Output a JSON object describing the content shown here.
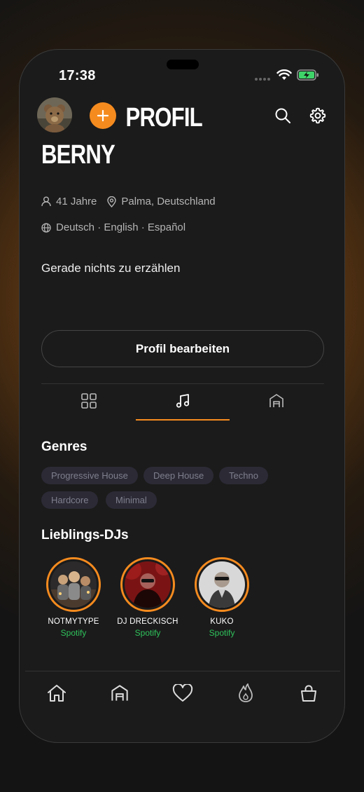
{
  "status_bar": {
    "time": "17:38"
  },
  "header": {
    "title_line1": "PROFIL",
    "title_line2": "BERNY"
  },
  "profile": {
    "age": "41 Jahre",
    "location": "Palma, Deutschland",
    "languages": "Deutsch · English · Español",
    "bio": "Gerade nichts zu erzählen"
  },
  "edit_button": {
    "label": "Profil bearbeiten"
  },
  "tabs": [
    {
      "icon": "grid-icon"
    },
    {
      "icon": "music-note-icon",
      "active": true
    },
    {
      "icon": "venue-icon"
    }
  ],
  "genres": {
    "title": "Genres",
    "items": [
      "Progressive House",
      "Deep House",
      "Techno",
      "Hardcore",
      "Minimal"
    ]
  },
  "favorite_djs": {
    "title": "Lieblings-DJs",
    "items": [
      {
        "name": "NOTMYTYPE",
        "source": "Spotify"
      },
      {
        "name": "DJ DRECKISCH",
        "source": "Spotify"
      },
      {
        "name": "KUKO",
        "source": "Spotify"
      }
    ]
  },
  "bottom_nav": [
    "home-icon",
    "venue-icon",
    "heart-icon",
    "flame-icon",
    "bag-icon"
  ],
  "colors": {
    "accent": "#f58b1f",
    "background": "#1b1b1b",
    "chip_bg": "#2b2a35",
    "spotify_green": "#2fc25b"
  }
}
